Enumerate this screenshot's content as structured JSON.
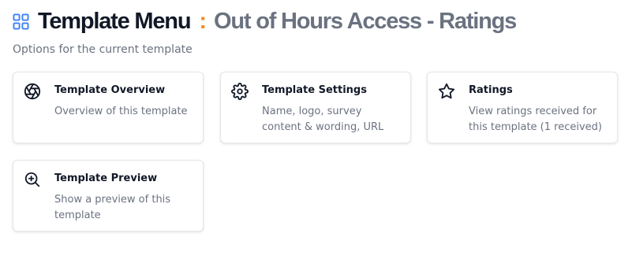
{
  "header": {
    "icon": "grid-icon",
    "title": "Template Menu",
    "separator": ":",
    "subtitle": "Out of Hours Access - Ratings",
    "accent_color": "#f28c28",
    "icon_color": "#3b82f6"
  },
  "description": "Options for the current template",
  "cards": [
    {
      "icon": "aperture-icon",
      "title": "Template Overview",
      "description": "Overview of this template"
    },
    {
      "icon": "gear-icon",
      "title": "Template Settings",
      "description": "Name, logo, survey content & wording, URL"
    },
    {
      "icon": "star-icon",
      "title": "Ratings",
      "description": "View ratings received for this template (1 received)"
    },
    {
      "icon": "zoom-in-icon",
      "title": "Template Preview",
      "description": "Show a preview of this template"
    }
  ]
}
